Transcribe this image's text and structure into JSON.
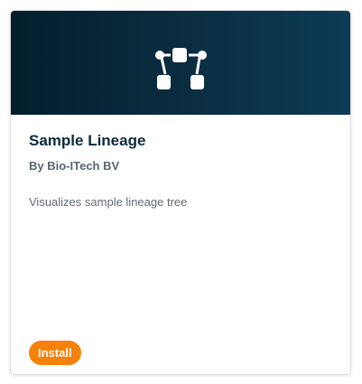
{
  "card": {
    "icon": "lineage-tree-icon",
    "title": "Sample Lineage",
    "vendor": "By Bio-ITech BV",
    "description": "Visualizes sample lineage tree",
    "install_label": "Install"
  },
  "colors": {
    "banner_dark": "#041e2d",
    "banner_light": "#0d3b55",
    "title": "#0c2a3c",
    "install_button": "#f5800a"
  }
}
